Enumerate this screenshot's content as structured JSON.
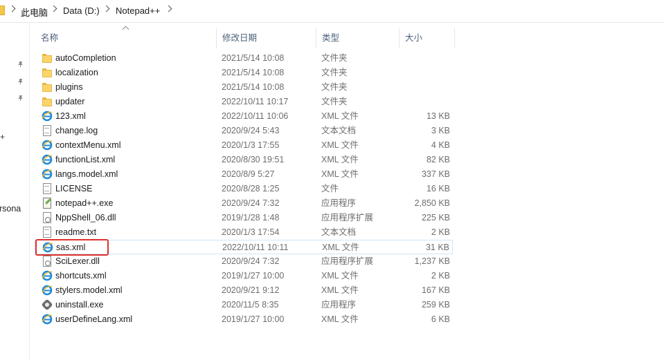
{
  "address": {
    "crumbs": [
      "此电脑",
      "Data (D:)",
      "Notepad++"
    ]
  },
  "nav": {
    "plus": "+",
    "partial_label": "ersona"
  },
  "columns": {
    "name": "名称",
    "date": "修改日期",
    "type": "类型",
    "size": "大小"
  },
  "rows": [
    {
      "name": "autoCompletion",
      "date": "2021/5/14 10:08",
      "type": "文件夹",
      "size": "",
      "icon": "folder-icon"
    },
    {
      "name": "localization",
      "date": "2021/5/14 10:08",
      "type": "文件夹",
      "size": "",
      "icon": "folder-icon"
    },
    {
      "name": "plugins",
      "date": "2021/5/14 10:08",
      "type": "文件夹",
      "size": "",
      "icon": "folder-icon"
    },
    {
      "name": "updater",
      "date": "2022/10/11 10:17",
      "type": "文件夹",
      "size": "",
      "icon": "folder-icon"
    },
    {
      "name": "123.xml",
      "date": "2022/10/11 10:06",
      "type": "XML 文件",
      "size": "13 KB",
      "icon": "xml-file-icon"
    },
    {
      "name": "change.log",
      "date": "2020/9/24 5:43",
      "type": "文本文档",
      "size": "3 KB",
      "icon": "text-file-icon"
    },
    {
      "name": "contextMenu.xml",
      "date": "2020/1/3 17:55",
      "type": "XML 文件",
      "size": "4 KB",
      "icon": "xml-file-icon"
    },
    {
      "name": "functionList.xml",
      "date": "2020/8/30 19:51",
      "type": "XML 文件",
      "size": "82 KB",
      "icon": "xml-file-icon"
    },
    {
      "name": "langs.model.xml",
      "date": "2020/8/9 5:27",
      "type": "XML 文件",
      "size": "337 KB",
      "icon": "xml-file-icon"
    },
    {
      "name": "LICENSE",
      "date": "2020/8/28 1:25",
      "type": "文件",
      "size": "16 KB",
      "icon": "file-icon"
    },
    {
      "name": "notepad++.exe",
      "date": "2020/9/24 7:32",
      "type": "应用程序",
      "size": "2,850 KB",
      "icon": "notepad-exe-icon"
    },
    {
      "name": "NppShell_06.dll",
      "date": "2019/1/28 1:48",
      "type": "应用程序扩展",
      "size": "225 KB",
      "icon": "dll-file-icon"
    },
    {
      "name": "readme.txt",
      "date": "2020/1/3 17:54",
      "type": "文本文档",
      "size": "2 KB",
      "icon": "text-file-icon"
    },
    {
      "name": "sas.xml",
      "date": "2022/10/11 10:11",
      "type": "XML 文件",
      "size": "31 KB",
      "icon": "xml-file-icon"
    },
    {
      "name": "SciLexer.dll",
      "date": "2020/9/24 7:32",
      "type": "应用程序扩展",
      "size": "1,237 KB",
      "icon": "dll-file-icon"
    },
    {
      "name": "shortcuts.xml",
      "date": "2019/1/27 10:00",
      "type": "XML 文件",
      "size": "2 KB",
      "icon": "xml-file-icon"
    },
    {
      "name": "stylers.model.xml",
      "date": "2020/9/21 9:12",
      "type": "XML 文件",
      "size": "167 KB",
      "icon": "xml-file-icon"
    },
    {
      "name": "uninstall.exe",
      "date": "2020/11/5 8:35",
      "type": "应用程序",
      "size": "259 KB",
      "icon": "uninstall-exe-icon"
    },
    {
      "name": "userDefineLang.xml",
      "date": "2019/1/27 10:00",
      "type": "XML 文件",
      "size": "6 KB",
      "icon": "xml-file-icon"
    }
  ],
  "colors": {
    "highlight": "#e0302c",
    "hover_border": "#cde6f7",
    "folder": "#fcd56a",
    "header_text": "#4c607a"
  }
}
